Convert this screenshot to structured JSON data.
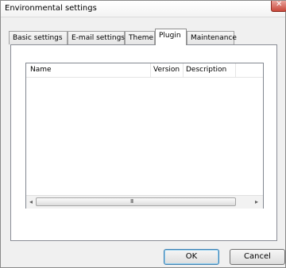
{
  "window": {
    "title": "Environmental settings"
  },
  "tabs": [
    {
      "label": "Basic settings"
    },
    {
      "label": "E-mail settings"
    },
    {
      "label": "Theme"
    },
    {
      "label": "Plugin"
    },
    {
      "label": "Maintenance"
    }
  ],
  "active_tab": "Plugin",
  "plugin_list": {
    "columns": [
      {
        "label": "Name"
      },
      {
        "label": "Version"
      },
      {
        "label": "Description"
      }
    ],
    "rows": []
  },
  "buttons": {
    "ok": "OK",
    "cancel": "Cancel"
  },
  "icons": {
    "close": "close-icon",
    "scroll_left": "chevron-left-icon",
    "scroll_right": "chevron-right-icon"
  }
}
